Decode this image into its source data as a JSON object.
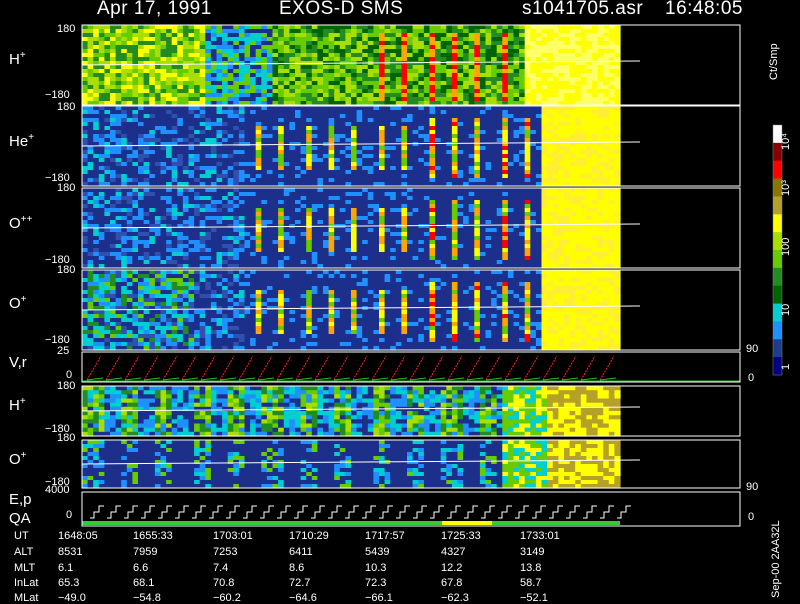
{
  "header": {
    "date": "Apr 17, 1991",
    "mission": "EXOS-D SMS",
    "file": "s1041705.asr",
    "time": "16:48:05"
  },
  "colorbar": {
    "unit_label": "Ct/Smp",
    "tick_labels": [
      "10⁴",
      "10³",
      "100",
      "10",
      "1"
    ],
    "colors": [
      "#ffffff",
      "#8b0000",
      "#ff0000",
      "#8b7500",
      "#b5a028",
      "#ffff00",
      "#aadd00",
      "#66cc00",
      "#228b22",
      "#006400",
      "#00ced1",
      "#1e90ff",
      "#1e3c8c",
      "#000080"
    ]
  },
  "panels": {
    "p1": {
      "label": "H",
      "sup": "+",
      "ymax": "180",
      "ymin": "−180"
    },
    "p2": {
      "label": "He",
      "sup": "+",
      "ymax": "180",
      "ymin": "−180"
    },
    "p3": {
      "label": "O",
      "sup": "++",
      "ymax": "180",
      "ymin": "−180"
    },
    "p4": {
      "label": "O",
      "sup": "+",
      "ymax": "180",
      "ymin": "−180"
    },
    "p5": {
      "label": "V,r",
      "ymax": "25",
      "ymin": "0",
      "rmax": "90",
      "rmin": "0"
    },
    "p6": {
      "label": "H",
      "sup": "+",
      "ymax": "180",
      "ymin": "−180"
    },
    "p7": {
      "label": "O",
      "sup": "+",
      "ymax": "180",
      "ymin": "−180"
    },
    "p8": {
      "label1": "E,p",
      "label2": "QA",
      "ymax": "4000",
      "ymin": "0",
      "rmax": "90",
      "rmin": "0"
    }
  },
  "footer": {
    "row_labels": [
      "UT",
      "ALT",
      "MLT",
      "InLat",
      "MLat"
    ],
    "columns": [
      [
        "1648:05",
        "8531",
        "6.1",
        "65.3",
        "−49.0"
      ],
      [
        "1655:33",
        "7959",
        "6.6",
        "68.1",
        "−54.8"
      ],
      [
        "1703:01",
        "7253",
        "7.4",
        "70.8",
        "−60.2"
      ],
      [
        "1710:29",
        "6411",
        "8.6",
        "72.7",
        "−64.6"
      ],
      [
        "1717:57",
        "5439",
        "10.3",
        "72.3",
        "−66.1"
      ],
      [
        "1725:33",
        "4327",
        "12.2",
        "67.8",
        "−62.3"
      ],
      [
        "1733:01",
        "3149",
        "13.8",
        "58.7",
        "−52.1"
      ]
    ],
    "side_note": "Sep-00 2AA32L"
  },
  "chart_data": {
    "type": "heatmap",
    "title": "Apr 17, 1991   EXOS-D SMS",
    "x_tick_labels": [
      "1648:05",
      "1655:33",
      "1703:01",
      "1710:29",
      "1717:57",
      "1725:33",
      "1733:01"
    ],
    "panels": [
      {
        "label": "H+",
        "ylim": [
          -180,
          180
        ]
      },
      {
        "label": "He+",
        "ylim": [
          -180,
          180
        ]
      },
      {
        "label": "O++",
        "ylim": [
          -180,
          180
        ]
      },
      {
        "label": "O+",
        "ylim": [
          -180,
          180
        ]
      },
      {
        "label": "V,r",
        "ylim": [
          0,
          25
        ],
        "y2lim": [
          0,
          90
        ]
      },
      {
        "label": "H+",
        "ylim": [
          -180,
          180
        ]
      },
      {
        "label": "O+",
        "ylim": [
          -180,
          180
        ]
      },
      {
        "label": "E,p QA",
        "ylim": [
          0,
          4000
        ],
        "y2lim": [
          0,
          90
        ]
      }
    ],
    "colorbar": {
      "label": "Ct/Smp",
      "scale": "log",
      "range": [
        1,
        10000
      ]
    }
  }
}
